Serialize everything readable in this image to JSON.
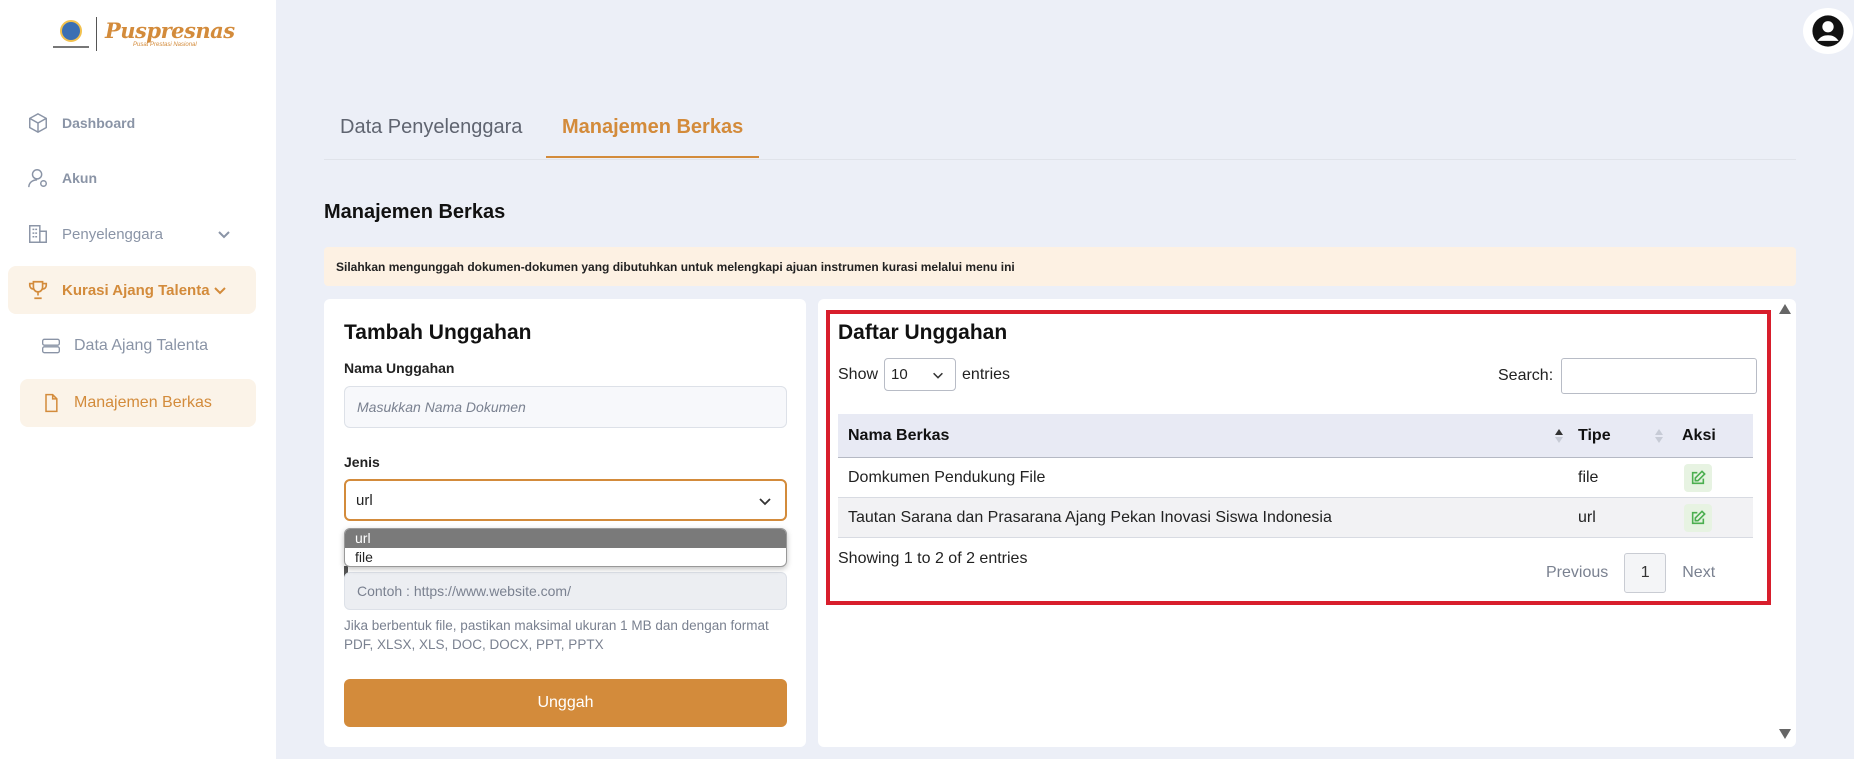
{
  "brand": {
    "name": "Puspresnas",
    "subtitle": "Pusat Prestasi Nasional"
  },
  "sidebar": {
    "items": [
      {
        "label": "Dashboard",
        "icon": "cube-icon"
      },
      {
        "label": "Akun",
        "icon": "user-icon"
      },
      {
        "label": "Penyelenggara",
        "icon": "building-icon"
      },
      {
        "label": "Kurasi Ajang Talenta",
        "icon": "trophy-icon"
      }
    ],
    "subitems": [
      {
        "label": "Data Ajang Talenta",
        "icon": "database-icon"
      },
      {
        "label": "Manajemen Berkas",
        "icon": "file-icon"
      }
    ]
  },
  "tabs": [
    {
      "label": "Data Penyelenggara"
    },
    {
      "label": "Manajemen Berkas"
    }
  ],
  "page": {
    "title": "Manajemen Berkas",
    "notice": "Silahkan mengunggah dokumen-dokumen yang dibutuhkan untuk melengkapi ajuan instrumen kurasi melalui menu ini"
  },
  "form": {
    "title": "Tambah Unggahan",
    "name_label": "Nama Unggahan",
    "name_placeholder": "Masukkan Nama Dokumen",
    "type_label": "Jenis",
    "type_value": "url",
    "type_options": [
      "url",
      "file"
    ],
    "url_placeholder": "Contoh : https://www.website.com/",
    "help": "Jika berbentuk file, pastikan maksimal ukuran 1 MB dan dengan format PDF, XLSX, XLS, DOC, DOCX, PPT, PPTX",
    "submit_label": "Unggah"
  },
  "list": {
    "title": "Daftar Unggahan",
    "show_label": "Show",
    "entries_value": "10",
    "entries_label": "entries",
    "search_label": "Search:",
    "columns": [
      "Nama Berkas",
      "Tipe",
      "Aksi"
    ],
    "rows": [
      {
        "name": "Domkumen Pendukung File",
        "type": "file"
      },
      {
        "name": "Tautan Sarana dan Prasarana Ajang Pekan Inovasi Siswa Indonesia",
        "type": "url"
      }
    ],
    "info": "Showing 1 to 2 of 2 entries",
    "prev_label": "Previous",
    "page": "1",
    "next_label": "Next"
  },
  "colors": {
    "accent": "#d38b3b",
    "highlight": "#d81e2c",
    "edit": "#4caf50"
  }
}
